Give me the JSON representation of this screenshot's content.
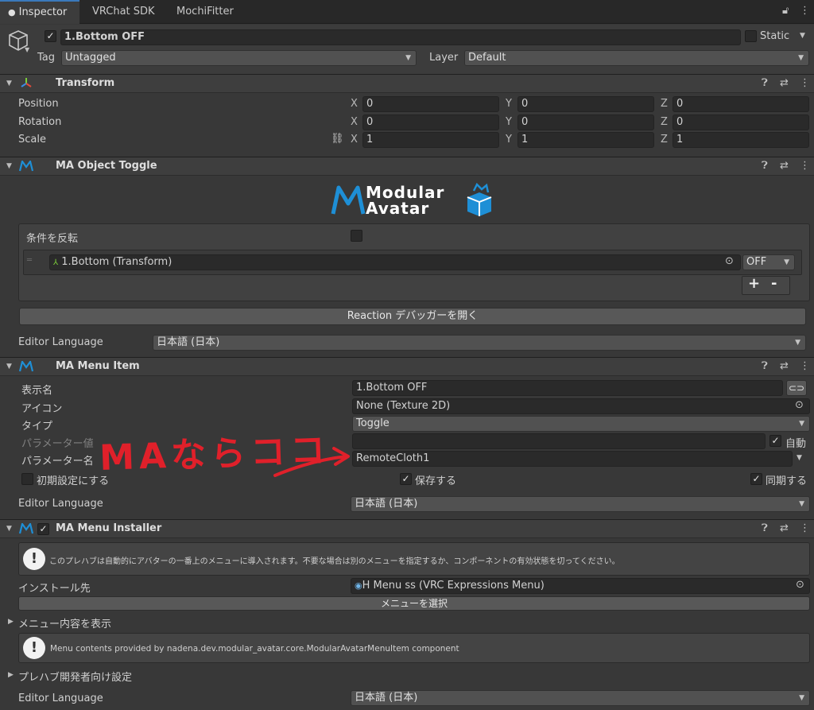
{
  "tabs": [
    {
      "label": "Inspector"
    },
    {
      "label": "VRChat SDK"
    },
    {
      "label": "MochiFitter"
    }
  ],
  "object": {
    "name": "1.Bottom OFF",
    "static_label": "Static",
    "tag_label": "Tag",
    "tag_value": "Untagged",
    "layer_label": "Layer",
    "layer_value": "Default"
  },
  "transform": {
    "title": "Transform",
    "rows": [
      {
        "label": "Position",
        "x": "0",
        "y": "0",
        "z": "0"
      },
      {
        "label": "Rotation",
        "x": "0",
        "y": "0",
        "z": "0"
      },
      {
        "label": "Scale",
        "x": "1",
        "y": "1",
        "z": "1"
      }
    ],
    "axes": {
      "x": "X",
      "y": "Y",
      "z": "Z"
    }
  },
  "object_toggle": {
    "title": "MA Object Toggle",
    "logo_line1": "Modular",
    "logo_line2": "Avatar",
    "invert_label": "条件を反転",
    "item_target": "1.Bottom (Transform)",
    "item_state": "OFF",
    "plus": "+",
    "minus": "-",
    "debugger_button": "Reaction デバッガーを開く",
    "editor_language_label": "Editor Language",
    "editor_language_value": "日本語 (日本)"
  },
  "menu_item": {
    "title": "MA Menu Item",
    "display_name_label": "表示名",
    "display_name_value": "1.Bottom OFF",
    "icon_label": "アイコン",
    "icon_value": "None (Texture 2D)",
    "type_label": "タイプ",
    "type_value": "Toggle",
    "param_value_label": "パラメーター値",
    "auto_label": "自動",
    "param_name_label": "パラメーター名",
    "param_name_value": "RemoteCloth1",
    "default_label": "初期設定にする",
    "saved_label": "保存する",
    "synced_label": "同期する",
    "editor_language_label": "Editor Language",
    "editor_language_value": "日本語 (日本)"
  },
  "annotation": {
    "text": "MAならココ"
  },
  "menu_installer": {
    "title": "MA Menu Installer",
    "help_text": "このプレハブは自動的にアバターの一番上のメニューに導入されます。不要な場合は別のメニューを指定するか、コンポーネントの有効状態を切ってください。",
    "install_target_label": "インストール先",
    "install_target_value": "H Menu ss (VRC Expressions Menu)",
    "select_menu_button": "メニューを選択",
    "show_contents_label": "メニュー内容を表示",
    "contents_help": "Menu contents provided by nadena.dev.modular_avatar.core.ModularAvatarMenuItem component",
    "prefab_dev_label": "プレハブ開発者向け設定",
    "editor_language_label": "Editor Language",
    "editor_language_value": "日本語 (日本)"
  },
  "colors": {
    "accent": "#3a79bb",
    "ma_blue": "#1e8fd6",
    "annotation_red": "#e0202a"
  }
}
